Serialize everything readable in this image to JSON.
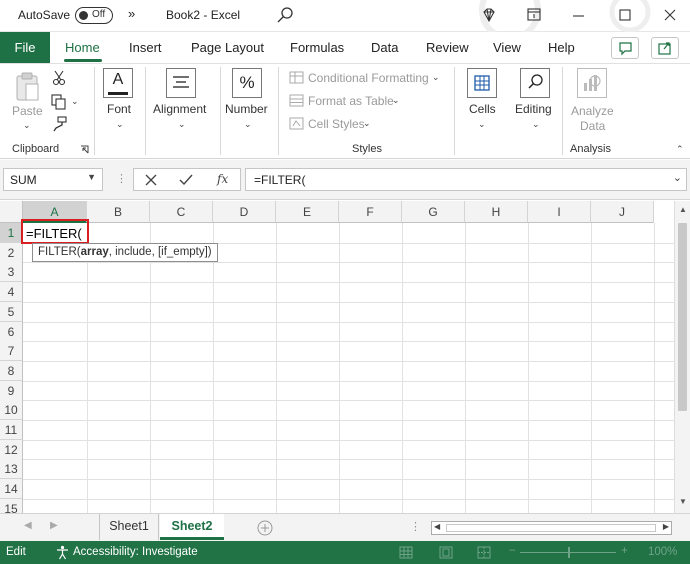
{
  "titlebar": {
    "autosave_label": "AutoSave",
    "autosave_state": "Off",
    "more_glyph": "»",
    "doc_title": "Book2  -  Excel"
  },
  "tabs": {
    "file": "File",
    "home": "Home",
    "insert": "Insert",
    "page_layout": "Page Layout",
    "formulas": "Formulas",
    "data": "Data",
    "review": "Review",
    "view": "View",
    "help": "Help"
  },
  "ribbon": {
    "paste": "Paste",
    "clipboard": "Clipboard",
    "font": "Font",
    "alignment": "Alignment",
    "number": "Number",
    "conditional_formatting": "Conditional Formatting",
    "format_as_table": "Format as Table",
    "cell_styles": "Cell Styles",
    "styles": "Styles",
    "cells": "Cells",
    "editing": "Editing",
    "analyze": "Analyze",
    "data_label": "Data",
    "analysis": "Analysis",
    "number_glyph": "%",
    "font_glyph": "A"
  },
  "formula_bar": {
    "name_box": "SUM",
    "fx": "fx",
    "formula": "=FILTER("
  },
  "grid": {
    "columns": [
      "A",
      "B",
      "C",
      "D",
      "E",
      "F",
      "G",
      "H",
      "I",
      "J"
    ],
    "rows": [
      "1",
      "2",
      "3",
      "4",
      "5",
      "6",
      "7",
      "8",
      "9",
      "10",
      "11",
      "12",
      "13",
      "14",
      "15"
    ],
    "active_cell_value": "=FILTER(",
    "tooltip_prefix": "FILTER(",
    "tooltip_bold": "array",
    "tooltip_rest": ", include, [if_empty])"
  },
  "sheets": {
    "sheet1": "Sheet1",
    "sheet2": "Sheet2"
  },
  "status": {
    "mode": "Edit",
    "accessibility": "Accessibility: Investigate",
    "zoom": "100%"
  },
  "colors": {
    "brand_green": "#1e7145",
    "status_green": "#217346",
    "highlight_red": "#d81e1e"
  }
}
